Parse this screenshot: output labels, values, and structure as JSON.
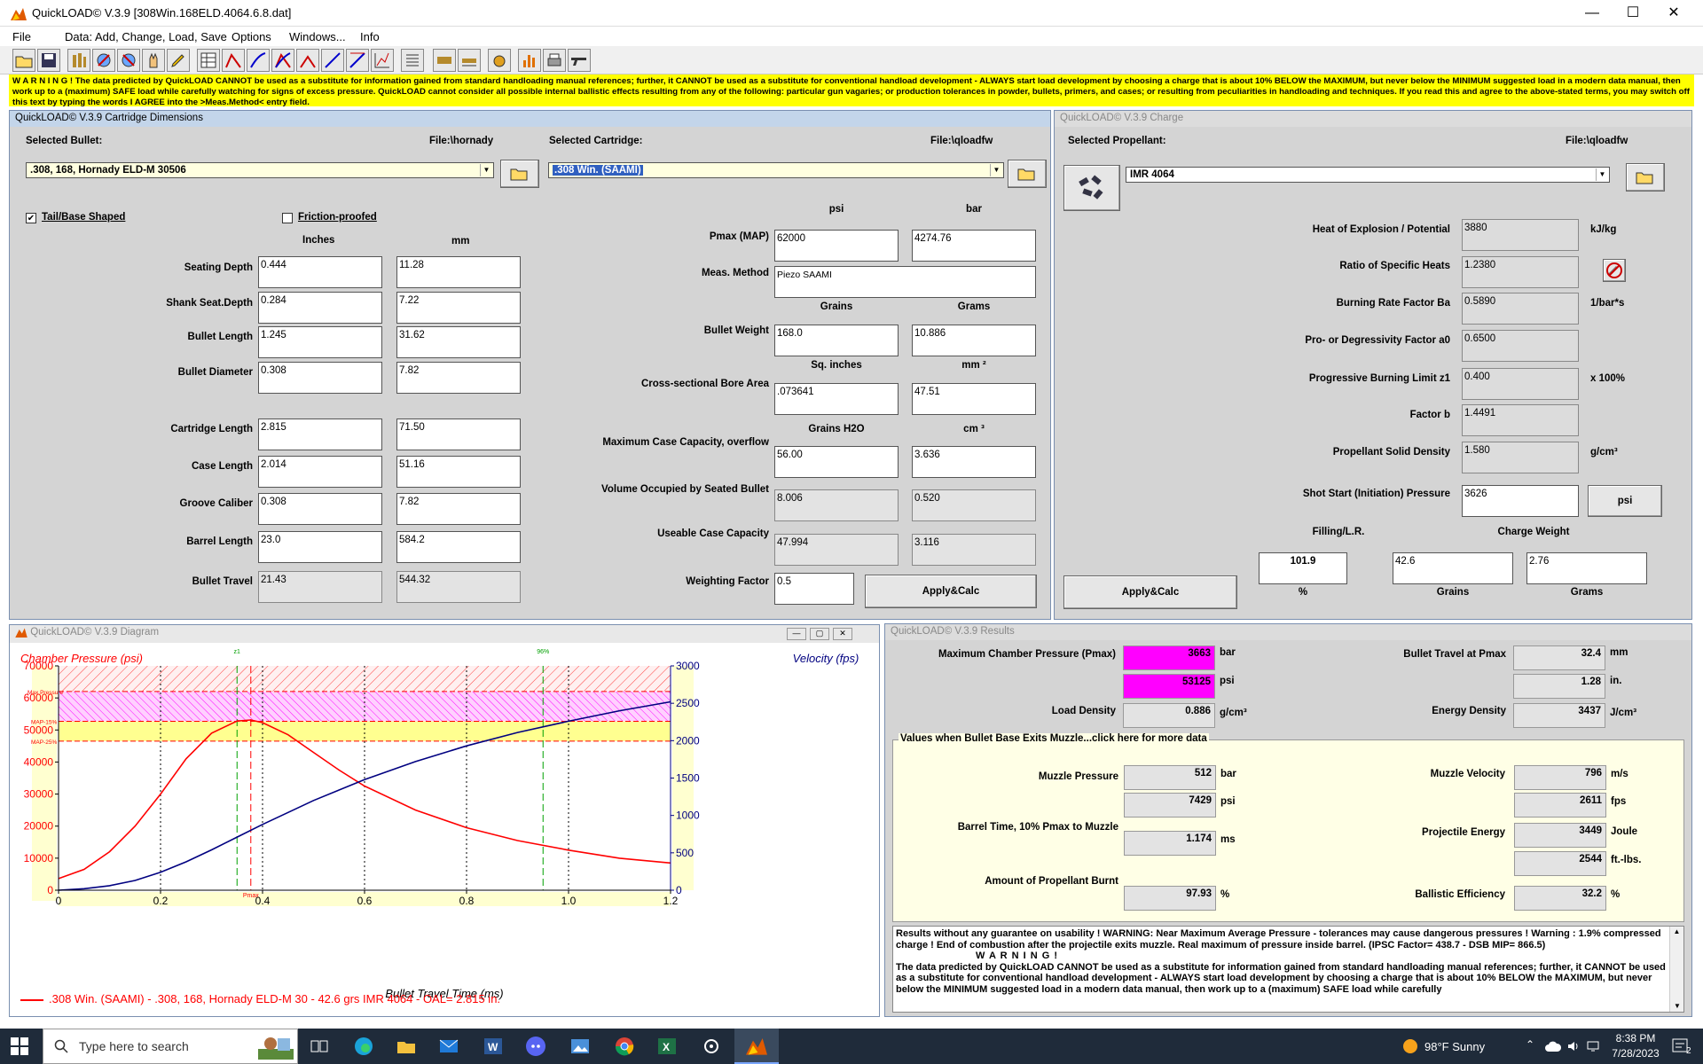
{
  "window": {
    "title": "QuickLOAD© V.3.9   [308Win.168ELD.4064.6.8.dat]",
    "minimize": "—",
    "maximize": "☐",
    "close": "✕"
  },
  "menu": [
    "File",
    "Data: Add, Change, Load, Save",
    "Options",
    "Windows...",
    "Info"
  ],
  "warning_text": "W A R N I N G ! The data predicted by QuickLOAD CANNOT be used as a substitute for information gained from standard handloading manual references; further, it CANNOT be used as a substitute for conventional handload development - ALWAYS start load development by choosing a charge that is about 10% BELOW the MAXIMUM, but never below the MINIMUM suggested load in a modern data manual, then work up to a (maximum) SAFE load while carefully watching for signs of excess pressure. QuickLOAD cannot consider all possible internal ballistic effects resulting from any of the following: particular gun vagaries; or production tolerances in powder, bullets, primers, and cases; or resulting from peculiarities in handloading and techniques. If you read this and agree to the above-stated terms, you may switch off this text by typing the words I AGREE into the >Meas.Method< entry field.",
  "cart": {
    "title": "QuickLOAD© V.3.9 Cartridge Dimensions",
    "selected_bullet_label": "Selected Bullet:",
    "bullet_file": "File:\\hornady",
    "bullet_value": ".308, 168, Hornady ELD-M 30506",
    "selected_cartridge_label": "Selected Cartridge:",
    "cartridge_file": "File:\\qloadfw",
    "cartridge_value": ".308 Win. (SAAMI)",
    "tail_label": "Tail/Base Shaped",
    "tail_checked": "✔",
    "friction_label": "Friction-proofed",
    "col_inches": "Inches",
    "col_mm": "mm",
    "rows": [
      {
        "label": "Seating Depth",
        "in": "0.444",
        "mm": "11.28"
      },
      {
        "label": "Shank Seat.Depth",
        "in": "0.284",
        "mm": "7.22"
      },
      {
        "label": "Bullet Length",
        "in": "1.245",
        "mm": "31.62"
      },
      {
        "label": "Bullet Diameter",
        "in": "0.308",
        "mm": "7.82"
      },
      {
        "label": "Cartridge Length",
        "in": "2.815",
        "mm": "71.50"
      },
      {
        "label": "Case Length",
        "in": "2.014",
        "mm": "51.16"
      },
      {
        "label": "Groove Caliber",
        "in": "0.308",
        "mm": "7.82"
      },
      {
        "label": "Barrel Length",
        "in": "23.0",
        "mm": "584.2"
      },
      {
        "label": "Bullet Travel",
        "in": "21.43",
        "mm": "544.32"
      }
    ],
    "col_psi": "psi",
    "col_bar": "bar",
    "pmax_label": "Pmax (MAP)",
    "pmax_psi": "62000",
    "pmax_bar": "4274.76",
    "meas_label": "Meas. Method",
    "meas_value": "Piezo SAAMI",
    "col_grains": "Grains",
    "col_grams": "Grams",
    "bw_label": "Bullet Weight",
    "bw_gr": "168.0",
    "bw_g": "10.886",
    "col_sqin": "Sq. inches",
    "col_mm2": "mm ²",
    "bore_label": "Cross-sectional Bore Area",
    "bore_in": ".073641",
    "bore_mm": "47.51",
    "col_gh2o": "Grains H2O",
    "col_cm3": "cm ³",
    "cap_label": "Maximum Case Capacity, overflow",
    "cap_gr": "56.00",
    "cap_cm": "3.636",
    "vol_label": "Volume Occupied by Seated Bullet",
    "vol_gr": "8.006",
    "vol_cm": "0.520",
    "use_label": "Useable Case Capacity",
    "use_gr": "47.994",
    "use_cm": "3.116",
    "wf_label": "Weighting Factor",
    "wf_value": "0.5",
    "apply": "Apply&Calc"
  },
  "charge": {
    "title": "QuickLOAD© V.3.9 Charge",
    "selected_label": "Selected Propellant:",
    "file": "File:\\qloadfw",
    "propellant": "IMR 4064",
    "rows": [
      {
        "label": "Heat of Explosion / Potential",
        "value": "3880",
        "unit": "kJ/kg"
      },
      {
        "label": "Ratio of Specific Heats",
        "value": "1.2380",
        "unit": ""
      },
      {
        "label": "Burning Rate Factor  Ba",
        "value": "0.5890",
        "unit": "1/bar*s"
      },
      {
        "label": "Pro- or Degressivity Factor  a0",
        "value": "0.6500",
        "unit": ""
      },
      {
        "label": "Progressive Burning Limit z1",
        "value": "0.400",
        "unit": "x 100%"
      },
      {
        "label": "Factor  b",
        "value": "1.4491",
        "unit": ""
      },
      {
        "label": "Propellant Solid Density",
        "value": "1.580",
        "unit": "g/cm³"
      },
      {
        "label": "Shot Start (Initiation) Pressure",
        "value": "3626",
        "unit": ""
      }
    ],
    "psi_btn": "psi",
    "filling_label": "Filling/L.R.",
    "charge_weight_label": "Charge Weight",
    "filling_value": "101.9",
    "filling_unit": "%",
    "charge_gr": "42.6",
    "charge_gr_unit": "Grains",
    "charge_g": "2.76",
    "charge_g_unit": "Grams",
    "apply": "Apply&Calc"
  },
  "diagram": {
    "title": "QuickLOAD© V.3.9 Diagram",
    "legend": ".308 Win. (SAAMI) - .308, 168, Hornady ELD-M 30 - 42.6 grs IMR 4064 - OAL= 2.815 in."
  },
  "chart_data": {
    "type": "line",
    "title": "",
    "xlabel": "Bullet Travel Time (ms)",
    "ylabel_left": "Chamber Pressure (psi)",
    "ylabel_right": "Velocity (fps)",
    "xlim": [
      0,
      1.2
    ],
    "ylim_left": [
      0,
      70000
    ],
    "ylim_right": [
      0,
      3000
    ],
    "x_ticks": [
      "0",
      "0.2",
      "0.4",
      "0.6",
      "0.8",
      "1.0",
      "1.2"
    ],
    "y_left_ticks": [
      "0",
      "10000",
      "20000",
      "30000",
      "40000",
      "50000",
      "60000",
      "70000"
    ],
    "y_right_ticks": [
      "0",
      "500",
      "1000",
      "1500",
      "2000",
      "2500",
      "3000"
    ],
    "annotations": [
      "Max Pressure",
      "MAP-15%",
      "MAP-25%",
      "z1",
      "96%",
      "Pmax"
    ],
    "pressure_color": "#ff0000",
    "velocity_color": "#000080",
    "series": [
      {
        "name": "Chamber Pressure",
        "x": [
          0,
          0.05,
          0.1,
          0.15,
          0.2,
          0.25,
          0.3,
          0.35,
          0.377,
          0.4,
          0.45,
          0.5,
          0.55,
          0.6,
          0.7,
          0.8,
          0.9,
          1.0,
          1.1,
          1.2
        ],
        "values": [
          3626,
          6500,
          12000,
          20000,
          30000,
          41000,
          49000,
          52800,
          53125,
          52300,
          48500,
          43000,
          37500,
          32500,
          25000,
          19500,
          15500,
          12500,
          10000,
          8500
        ]
      },
      {
        "name": "Velocity",
        "x": [
          0,
          0.05,
          0.1,
          0.15,
          0.2,
          0.25,
          0.3,
          0.35,
          0.4,
          0.45,
          0.5,
          0.6,
          0.7,
          0.8,
          0.9,
          1.0,
          1.1,
          1.2
        ],
        "values": [
          0,
          20,
          60,
          130,
          240,
          380,
          540,
          710,
          880,
          1040,
          1200,
          1480,
          1720,
          1930,
          2110,
          2260,
          2400,
          2520
        ]
      }
    ],
    "grid": true
  },
  "results": {
    "title": "QuickLOAD© V.3.9 Results",
    "pmax_label": "Maximum Chamber Pressure (Pmax)",
    "pmax_bar": "3663",
    "pmax_psi": "53125",
    "u_bar": "bar",
    "u_psi": "psi",
    "travel_label": "Bullet Travel at Pmax",
    "travel_mm": "32.4",
    "travel_in": "1.28",
    "u_mm": "mm",
    "u_in": "in.",
    "ld_label": "Load Density",
    "ld_value": "0.886",
    "u_gcm": "g/cm³",
    "ed_label": "Energy Density",
    "ed_value": "3437",
    "u_jcm": "J/cm³",
    "group_title": "Values when Bullet Base Exits Muzzle...click here for more data",
    "mp_label": "Muzzle Pressure",
    "mp_bar": "512",
    "mp_psi": "7429",
    "mv_label": "Muzzle Velocity",
    "mv_ms": "796",
    "mv_fps": "2611",
    "u_ms": "m/s",
    "u_fps": "fps",
    "bt_label": "Barrel Time, 10% Pmax to Muzzle",
    "bt_value": "1.174",
    "u_msec": "ms",
    "pe_label": "Projectile Energy",
    "pe_j": "3449",
    "pe_ft": "2544",
    "u_joule": "Joule",
    "u_ftlbs": "ft.-lbs.",
    "burnt_label": "Amount of Propellant Burnt",
    "burnt_value": "97.93",
    "u_pct": "%",
    "be_label": "Ballistic Efficiency",
    "be_value": "32.2",
    "notes": "Results without any guarantee on usability !  WARNING: Near Maximum Average Pressure - tolerances may cause dangerous pressures !  Warning : 1.9% compressed charge !  End of combustion after the projectile exits muzzle.  Real maximum of pressure inside barrel.  (IPSC Factor= 438.7 - DSB MIP= 866.5)",
    "notes_warn_title": "W A R N I N G !",
    "notes_warn": "The data predicted by QuickLOAD CANNOT be used as a substitute for information gained from standard handloading manual references; further, it CANNOT be used as a substitute for conventional handload development - ALWAYS start load development by choosing a charge that is about 10% BELOW the MAXIMUM, but never below the MINIMUM suggested load in a modern data manual, then work up to a (maximum) SAFE load while carefully"
  },
  "taskbar": {
    "search_placeholder": "Type here to search",
    "weather": "98°F  Sunny",
    "time": "8:38 PM",
    "date": "7/28/2023",
    "notif": "2"
  }
}
